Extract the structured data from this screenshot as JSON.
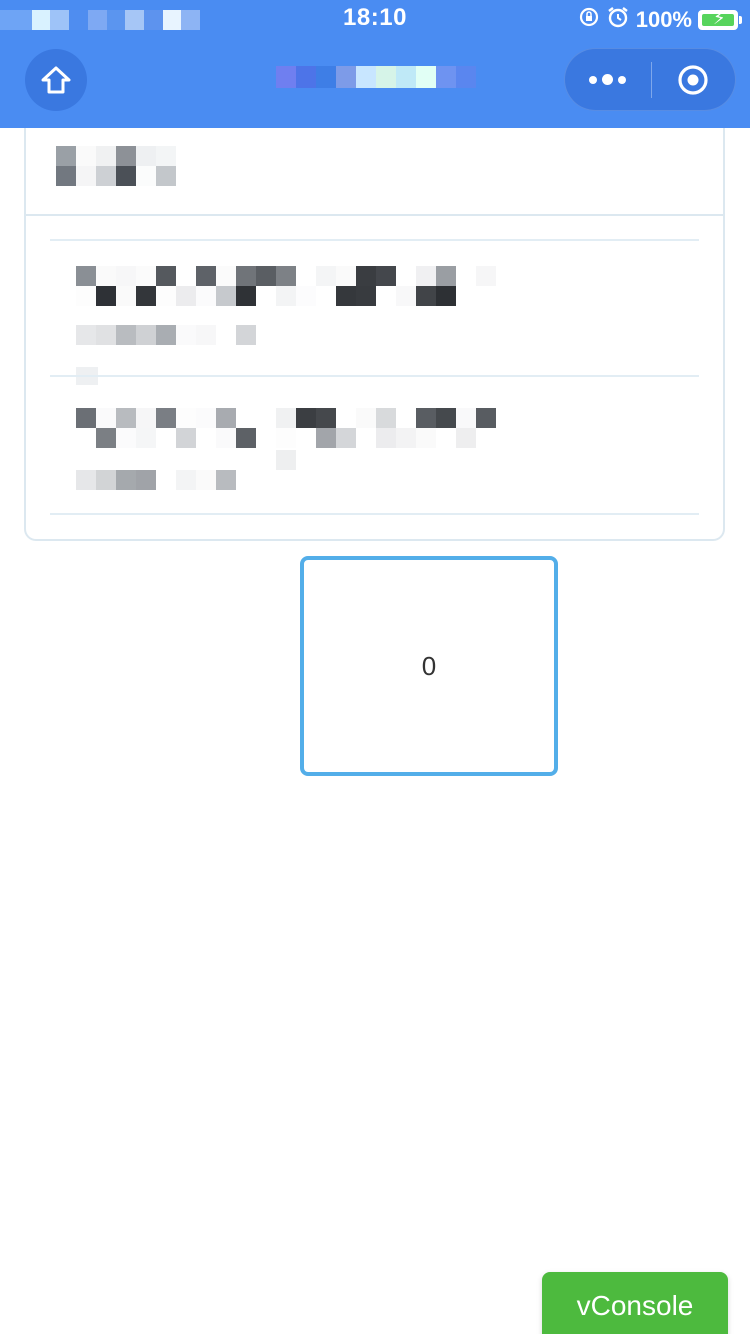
{
  "status_bar": {
    "time": "18:10",
    "battery_percent": "100%",
    "battery_level": 1.0,
    "icons": [
      "rotation-lock-icon",
      "alarm-icon",
      "battery-charging-icon"
    ]
  },
  "nav": {
    "home_icon": "home-icon",
    "more_icon": "more-dots-icon",
    "close_icon": "capsule-close-icon"
  },
  "counter": {
    "value": "0"
  },
  "vconsole": {
    "label": "vConsole"
  },
  "colors": {
    "header_bg": "#4a8cf2",
    "counter_border": "#53aee9",
    "vconsole_bg": "#4dba3e",
    "card_border": "#dce8f0"
  }
}
